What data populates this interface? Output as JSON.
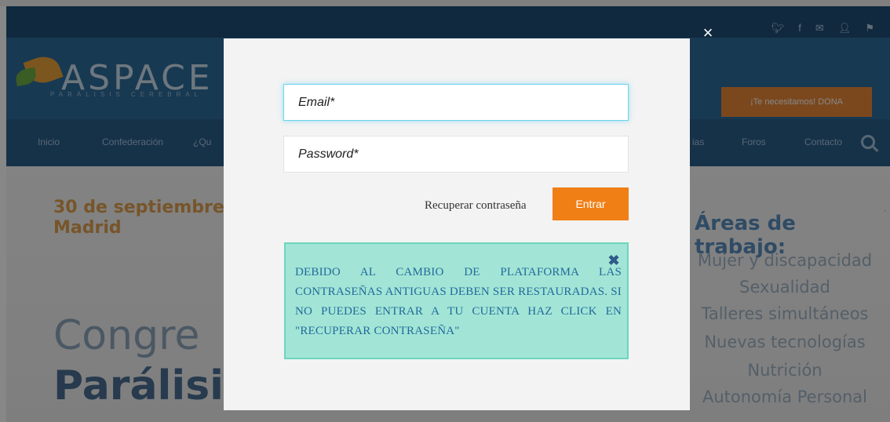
{
  "background": {
    "logo": "ASPACE",
    "logo_sub": "PARÁLISIS CEREBRAL",
    "dona_label": "¡Te necesitamos! DONA",
    "nav": [
      "Inicio",
      "Confederación",
      "¿Qu",
      "ias",
      "Foros",
      "Contacto"
    ],
    "hero_date_line1": "30 de septiembre y",
    "hero_date_line2": "Madrid",
    "hero_title_line1": "Congre",
    "hero_title_line2": "Parálisi",
    "areas_title": "Áreas de trabajo:",
    "areas": [
      "Mujer y discapacidad",
      "Sexualidad",
      "Talleres simultáneos",
      "Nuevas tecnologías",
      "Nutrición",
      "Autonomía Personal"
    ]
  },
  "modal": {
    "close_glyph": "×",
    "email_placeholder": "Email*",
    "password_placeholder": "Password*",
    "forgot_label": "Recuperar contraseña",
    "submit_label": "Entrar",
    "notice_text": "DEBIDO AL CAMBIO DE PLATAFORMA LAS CONTRASEÑAS ANTIGUAS DEBEN SER RESTAURADAS. SI NO PUEDES ENTRAR A TU CUENTA HAZ CLICK EN \"RECUPERAR CONTRASEÑA\"",
    "notice_close_glyph": "✖"
  },
  "colors": {
    "accent": "#f07f16",
    "notice_bg": "#a2e5d6",
    "notice_text": "#236a9c",
    "header": "#2f6c9c"
  }
}
